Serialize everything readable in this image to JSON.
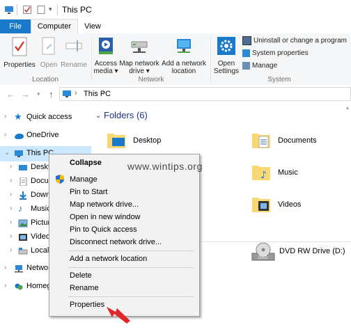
{
  "window": {
    "title": "This PC"
  },
  "tabs": [
    {
      "label": "File"
    },
    {
      "label": "Computer"
    },
    {
      "label": "View"
    }
  ],
  "ribbon": {
    "location": {
      "label": "Location",
      "buttons": [
        {
          "label": "Properties"
        },
        {
          "label": "Open"
        },
        {
          "label": "Rename"
        }
      ]
    },
    "network": {
      "label": "Network",
      "access_media": {
        "line1": "Access",
        "line2": "media ▾"
      },
      "map_drive": {
        "line1": "Map network",
        "line2": "drive ▾"
      },
      "add_location": {
        "line1": "Add a network",
        "line2": "location"
      }
    },
    "system": {
      "label": "System",
      "open_settings": {
        "line1": "Open",
        "line2": "Settings"
      },
      "uninstall": "Uninstall or change a program",
      "system_properties": "System properties",
      "manage": "Manage"
    }
  },
  "address": {
    "path": "This PC",
    "separator": "›"
  },
  "nav": {
    "items": [
      {
        "label": "Quick access"
      },
      {
        "label": "OneDrive"
      },
      {
        "label": "This PC"
      },
      {
        "label": "Deskto"
      },
      {
        "label": "Docum"
      },
      {
        "label": "Downl"
      },
      {
        "label": "Music"
      },
      {
        "label": "Pictur"
      },
      {
        "label": "Videos"
      },
      {
        "label": "Local D"
      },
      {
        "label": "Network"
      },
      {
        "label": "Homeg"
      }
    ]
  },
  "content": {
    "folders_header": "Folders (6)",
    "folders": [
      {
        "label": "Desktop"
      },
      {
        "label": "Documents"
      },
      {
        "label": "Music"
      },
      {
        "label": "Videos"
      }
    ],
    "drive": {
      "label": "DVD RW Drive (D:)"
    }
  },
  "context_menu": {
    "items": [
      {
        "label": "Collapse"
      },
      {
        "label": "Manage"
      },
      {
        "label": "Pin to Start"
      },
      {
        "label": "Map network drive..."
      },
      {
        "label": "Open in new window"
      },
      {
        "label": "Pin to Quick access"
      },
      {
        "label": "Disconnect network drive..."
      },
      {
        "label": "Add a network location"
      },
      {
        "label": "Delete"
      },
      {
        "label": "Rename"
      },
      {
        "label": "Properties"
      }
    ]
  },
  "watermark": "www.wintips.org",
  "colors": {
    "accent": "#1979ca",
    "selection": "#cce8ff",
    "folder": "#f8d775",
    "header": "#1e3287",
    "arrow": "#e0262b"
  }
}
